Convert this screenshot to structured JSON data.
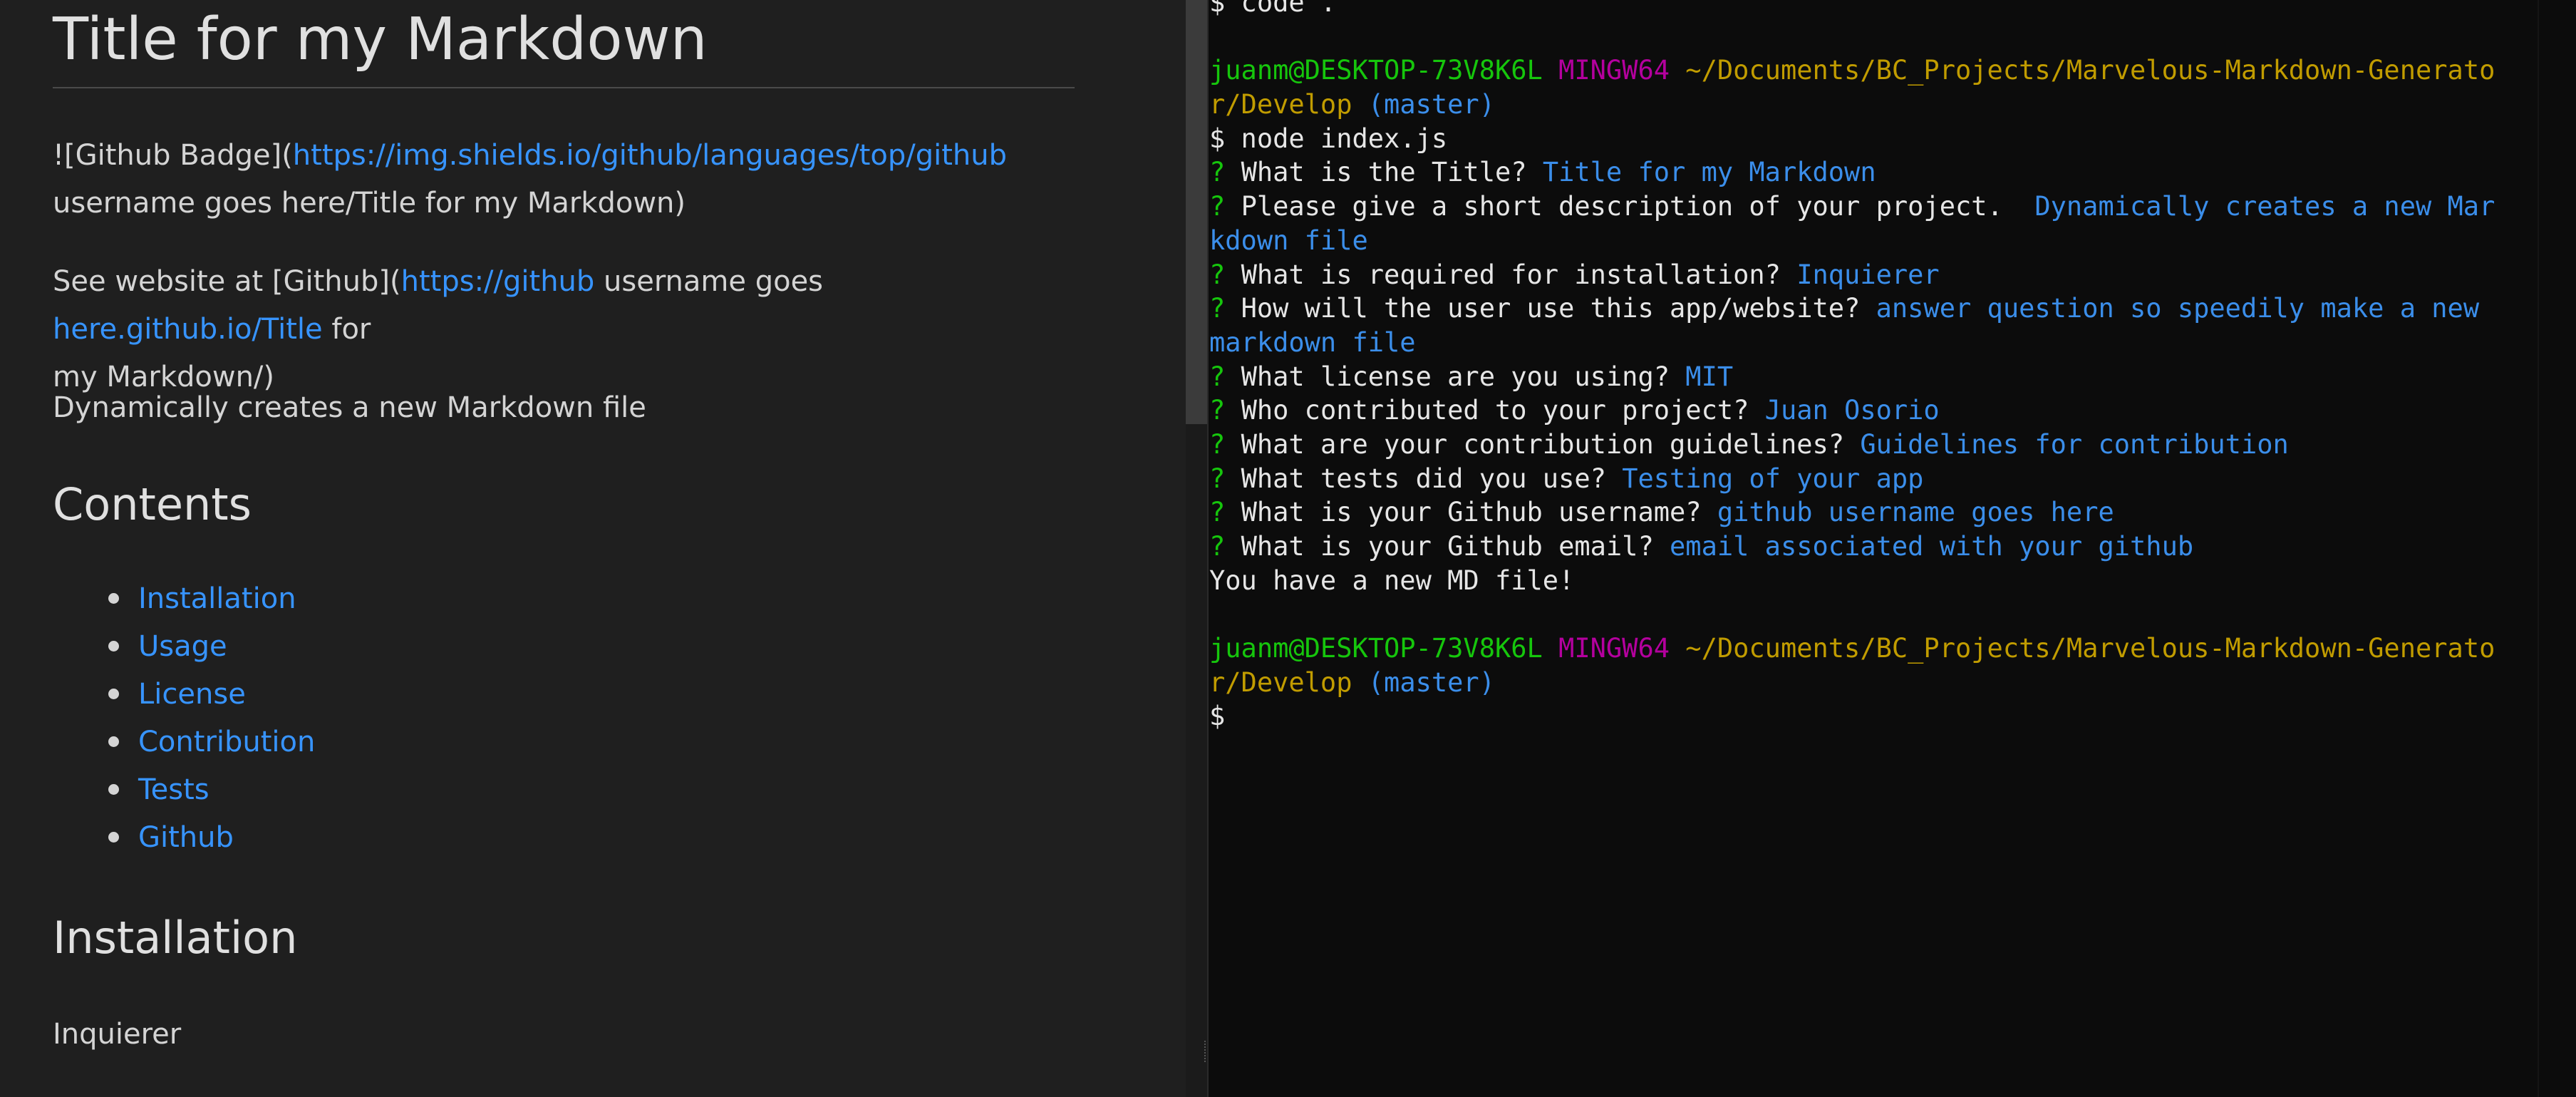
{
  "preview": {
    "title": "Title for my Markdown",
    "badge_line": {
      "prefix": "![Github Badge](",
      "link": "https://img.shields.io/github/languages/top/github",
      "suffix": "username goes here/Title for my Markdown)"
    },
    "website_line": {
      "prefix": "See website at [Github](",
      "link1": "https://github",
      "middle": " username goes ",
      "link2": "here.github.io/Title",
      "suffix": " for",
      "line2": "my Markdown/)"
    },
    "description": "Dynamically creates a new Markdown file",
    "contents_heading": "Contents",
    "toc": [
      "Installation",
      "Usage",
      "License",
      "Contribution",
      "Tests",
      "Github"
    ],
    "installation_heading": "Installation",
    "installation_text": "Inquierer"
  },
  "terminal": {
    "top_cut": "$ code .",
    "prompt1": {
      "user": "juanm@DESKTOP-73V8K6L",
      "shell": "MINGW64",
      "path_a": "~/Documents/BC_Projects/Marvelous-Markdown-Generato",
      "path_b": "r/Develop",
      "branch": "(master)"
    },
    "command": "$ node index.js",
    "qa": [
      {
        "q": "What is the Title? ",
        "a": "Title for my Markdown"
      },
      {
        "q": "Please give a short description of your project.  ",
        "a": "Dynamically creates a new Mar",
        "a2": "kdown file"
      },
      {
        "q": "What is required for installation? ",
        "a": "Inquierer"
      },
      {
        "q": "How will the user use this app/website? ",
        "a": "answer question so speedily make a new",
        "a2": "markdown file"
      },
      {
        "q": "What license are you using? ",
        "a": "MIT"
      },
      {
        "q": "Who contributed to your project? ",
        "a": "Juan Osorio"
      },
      {
        "q": "What are your contribution guidelines? ",
        "a": "Guidelines for contribution"
      },
      {
        "q": "What tests did you use? ",
        "a": "Testing of your app"
      },
      {
        "q": "What is your Github username? ",
        "a": "github username goes here"
      },
      {
        "q": "What is your Github email? ",
        "a": "email associated with your github"
      }
    ],
    "qmark": "?",
    "result": "You have a new MD file!",
    "prompt2": {
      "user": "juanm@DESKTOP-73V8K6L",
      "shell": "MINGW64",
      "path_a": "~/Documents/BC_Projects/Marvelous-Markdown-Generato",
      "path_b": "r/Develop",
      "branch": "(master)"
    },
    "final_prompt": "$"
  },
  "colors": {
    "preview_bg": "#1f1f1f",
    "terminal_bg": "#0c0c0c",
    "link": "#3794ff",
    "user_green": "#16c60c",
    "shell_purple": "#b4009e",
    "path_gold": "#c19c00",
    "answer_blue": "#3b8eea"
  }
}
